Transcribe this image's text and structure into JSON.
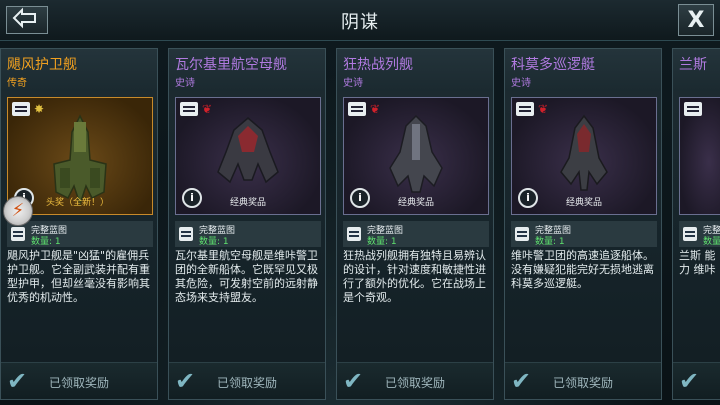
{
  "header": {
    "title": "阴谋",
    "back_icon": "back-arrow-icon",
    "close_label": "X"
  },
  "colors": {
    "legend": "#f0a020",
    "epic": "#b07ae0",
    "quantity": "#5ee06e",
    "accent": "#7fb6c2"
  },
  "cards": [
    {
      "title": "飓风护卫舰",
      "rarity": "传奇",
      "image_caption": "头奖（全新！）",
      "blueprint_name": "完整蓝图",
      "quantity": "数量: 1",
      "description": "飓风护卫舰是\"凶猛\"的雇佣兵护卫舰。它全副武装并配有重型护甲，但却丝毫没有影响其优秀的机动性。",
      "claim_label": "已领取奖励"
    },
    {
      "title": "瓦尔基里航空母舰",
      "rarity": "史诗",
      "image_caption": "经典奖品",
      "blueprint_name": "完整蓝图",
      "quantity": "数量: 1",
      "description": "瓦尔基里航空母舰是维咔警卫团的全新船体。它既罕见又极其危险，可发射空前的远射静态场来支持盟友。",
      "claim_label": "已领取奖励"
    },
    {
      "title": "狂热战列舰",
      "rarity": "史诗",
      "image_caption": "经典奖品",
      "blueprint_name": "完整蓝图",
      "quantity": "数量: 1",
      "description": "狂热战列舰拥有独特且易辨认的设计，针对速度和敏捷性进行了额外的优化。它在战场上是个奇观。",
      "claim_label": "已领取奖励"
    },
    {
      "title": "科莫多巡逻艇",
      "rarity": "史诗",
      "image_caption": "经典奖品",
      "blueprint_name": "完整蓝图",
      "quantity": "数量: 1",
      "description": "维咔警卫团的高速追逐船体。没有嫌疑犯能完好无损地逃离科莫多巡逻艇。",
      "claim_label": "已领取奖励"
    },
    {
      "title": "兰斯",
      "rarity": "",
      "image_caption": "",
      "blueprint_name": "完整",
      "quantity": "数量",
      "description": "兰斯 能力 维咔",
      "claim_label": ""
    }
  ]
}
